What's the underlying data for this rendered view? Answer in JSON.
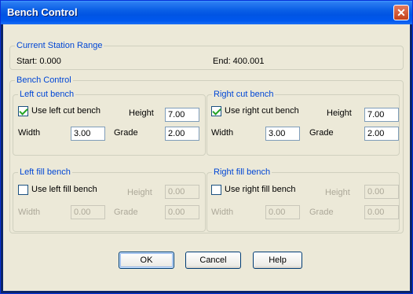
{
  "window": {
    "title": "Bench Control"
  },
  "station_range": {
    "legend": "Current Station Range",
    "start": "Start: 0.000",
    "end": "End: 400.001"
  },
  "bench_control": {
    "legend": "Bench Control"
  },
  "left_cut": {
    "legend": "Left cut bench",
    "checkbox_label": "Use left cut bench",
    "checked": true,
    "height_label": "Height",
    "height": "7.00",
    "width_label": "Width",
    "width": "3.00",
    "grade_label": "Grade",
    "grade": "2.00"
  },
  "right_cut": {
    "legend": "Right cut bench",
    "checkbox_label": "Use right cut bench",
    "checked": true,
    "height_label": "Height",
    "height": "7.00",
    "width_label": "Width",
    "width": "3.00",
    "grade_label": "Grade",
    "grade": "2.00"
  },
  "left_fill": {
    "legend": "Left fill bench",
    "checkbox_label": "Use left fill bench",
    "checked": false,
    "height_label": "Height",
    "height": "0.00",
    "width_label": "Width",
    "width": "0.00",
    "grade_label": "Grade",
    "grade": "0.00"
  },
  "right_fill": {
    "legend": "Right fill bench",
    "checkbox_label": "Use right fill bench",
    "checked": false,
    "height_label": "Height",
    "height": "0.00",
    "width_label": "Width",
    "width": "0.00",
    "grade_label": "Grade",
    "grade": "0.00"
  },
  "buttons": {
    "ok": "OK",
    "cancel": "Cancel",
    "help": "Help"
  }
}
